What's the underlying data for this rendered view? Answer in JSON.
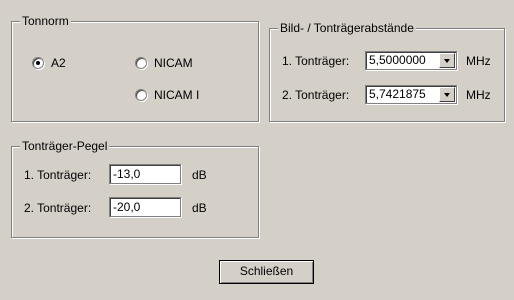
{
  "tonnorm": {
    "title": "Tonnorm",
    "options": [
      {
        "label": "A2",
        "selected": true
      },
      {
        "label": "NICAM",
        "selected": false
      },
      {
        "label": "NICAM I",
        "selected": false
      }
    ]
  },
  "abstaende": {
    "title": "Bild- / Tonträgerabstände",
    "rows": [
      {
        "label": "1. Tonträger:",
        "value": "5,5000000",
        "unit": "MHz"
      },
      {
        "label": "2. Tonträger:",
        "value": "5,7421875",
        "unit": "MHz"
      }
    ]
  },
  "pegel": {
    "title": "Tonträger-Pegel",
    "rows": [
      {
        "label": "1. Tonträger:",
        "value": "-13,0",
        "unit": "dB"
      },
      {
        "label": "2. Tonträger:",
        "value": "-20,0",
        "unit": "dB"
      }
    ]
  },
  "close_label": "Schließen"
}
